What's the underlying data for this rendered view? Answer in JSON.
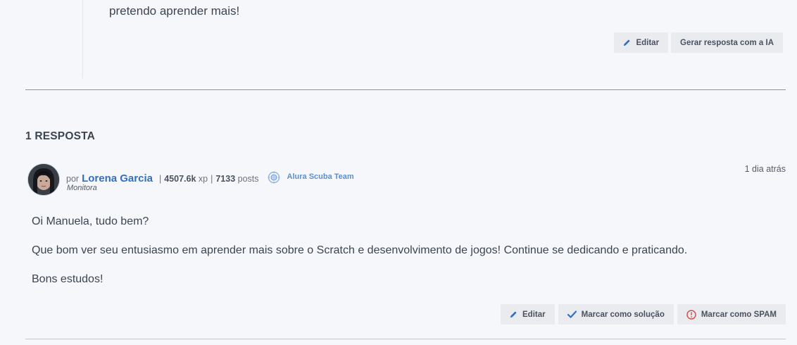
{
  "question": {
    "text_tail": "pretendo aprender mais!",
    "actions": {
      "edit_label": "Editar",
      "ai_label": "Gerar resposta com a IA"
    }
  },
  "answers": {
    "heading": "1 RESPOSTA",
    "items": [
      {
        "author": {
          "prefix": "por",
          "name": "Lorena Garcia",
          "xp_value": "4507.6k",
          "xp_unit": "xp",
          "posts_value": "7133",
          "posts_unit": "posts",
          "separator": "|",
          "team": "Alura Scuba Team",
          "role": "Monitora"
        },
        "timestamp": "1 dia atrás",
        "body": [
          "Oi Manuela, tudo bem?",
          "Que bom ver seu entusiasmo em aprender mais sobre o Scratch e desenvolvimento de jogos! Continue se dedicando e praticando.",
          "Bons estudos!"
        ],
        "actions": {
          "edit_label": "Editar",
          "solution_label": "Marcar como solução",
          "spam_label": "Marcar como SPAM"
        }
      }
    ]
  },
  "colors": {
    "background": "#f5f7fa",
    "author_link": "#2f6fc4",
    "team_badge": "#5a8fd0",
    "divider": "#6f9fb8",
    "spam_icon": "#d24b4b",
    "check_icon": "#2f6fc4"
  },
  "icons": {
    "edit": "pencil-icon",
    "solution": "checkmark-icon",
    "spam": "alert-circle-icon",
    "team": "diving-helmet-icon"
  }
}
